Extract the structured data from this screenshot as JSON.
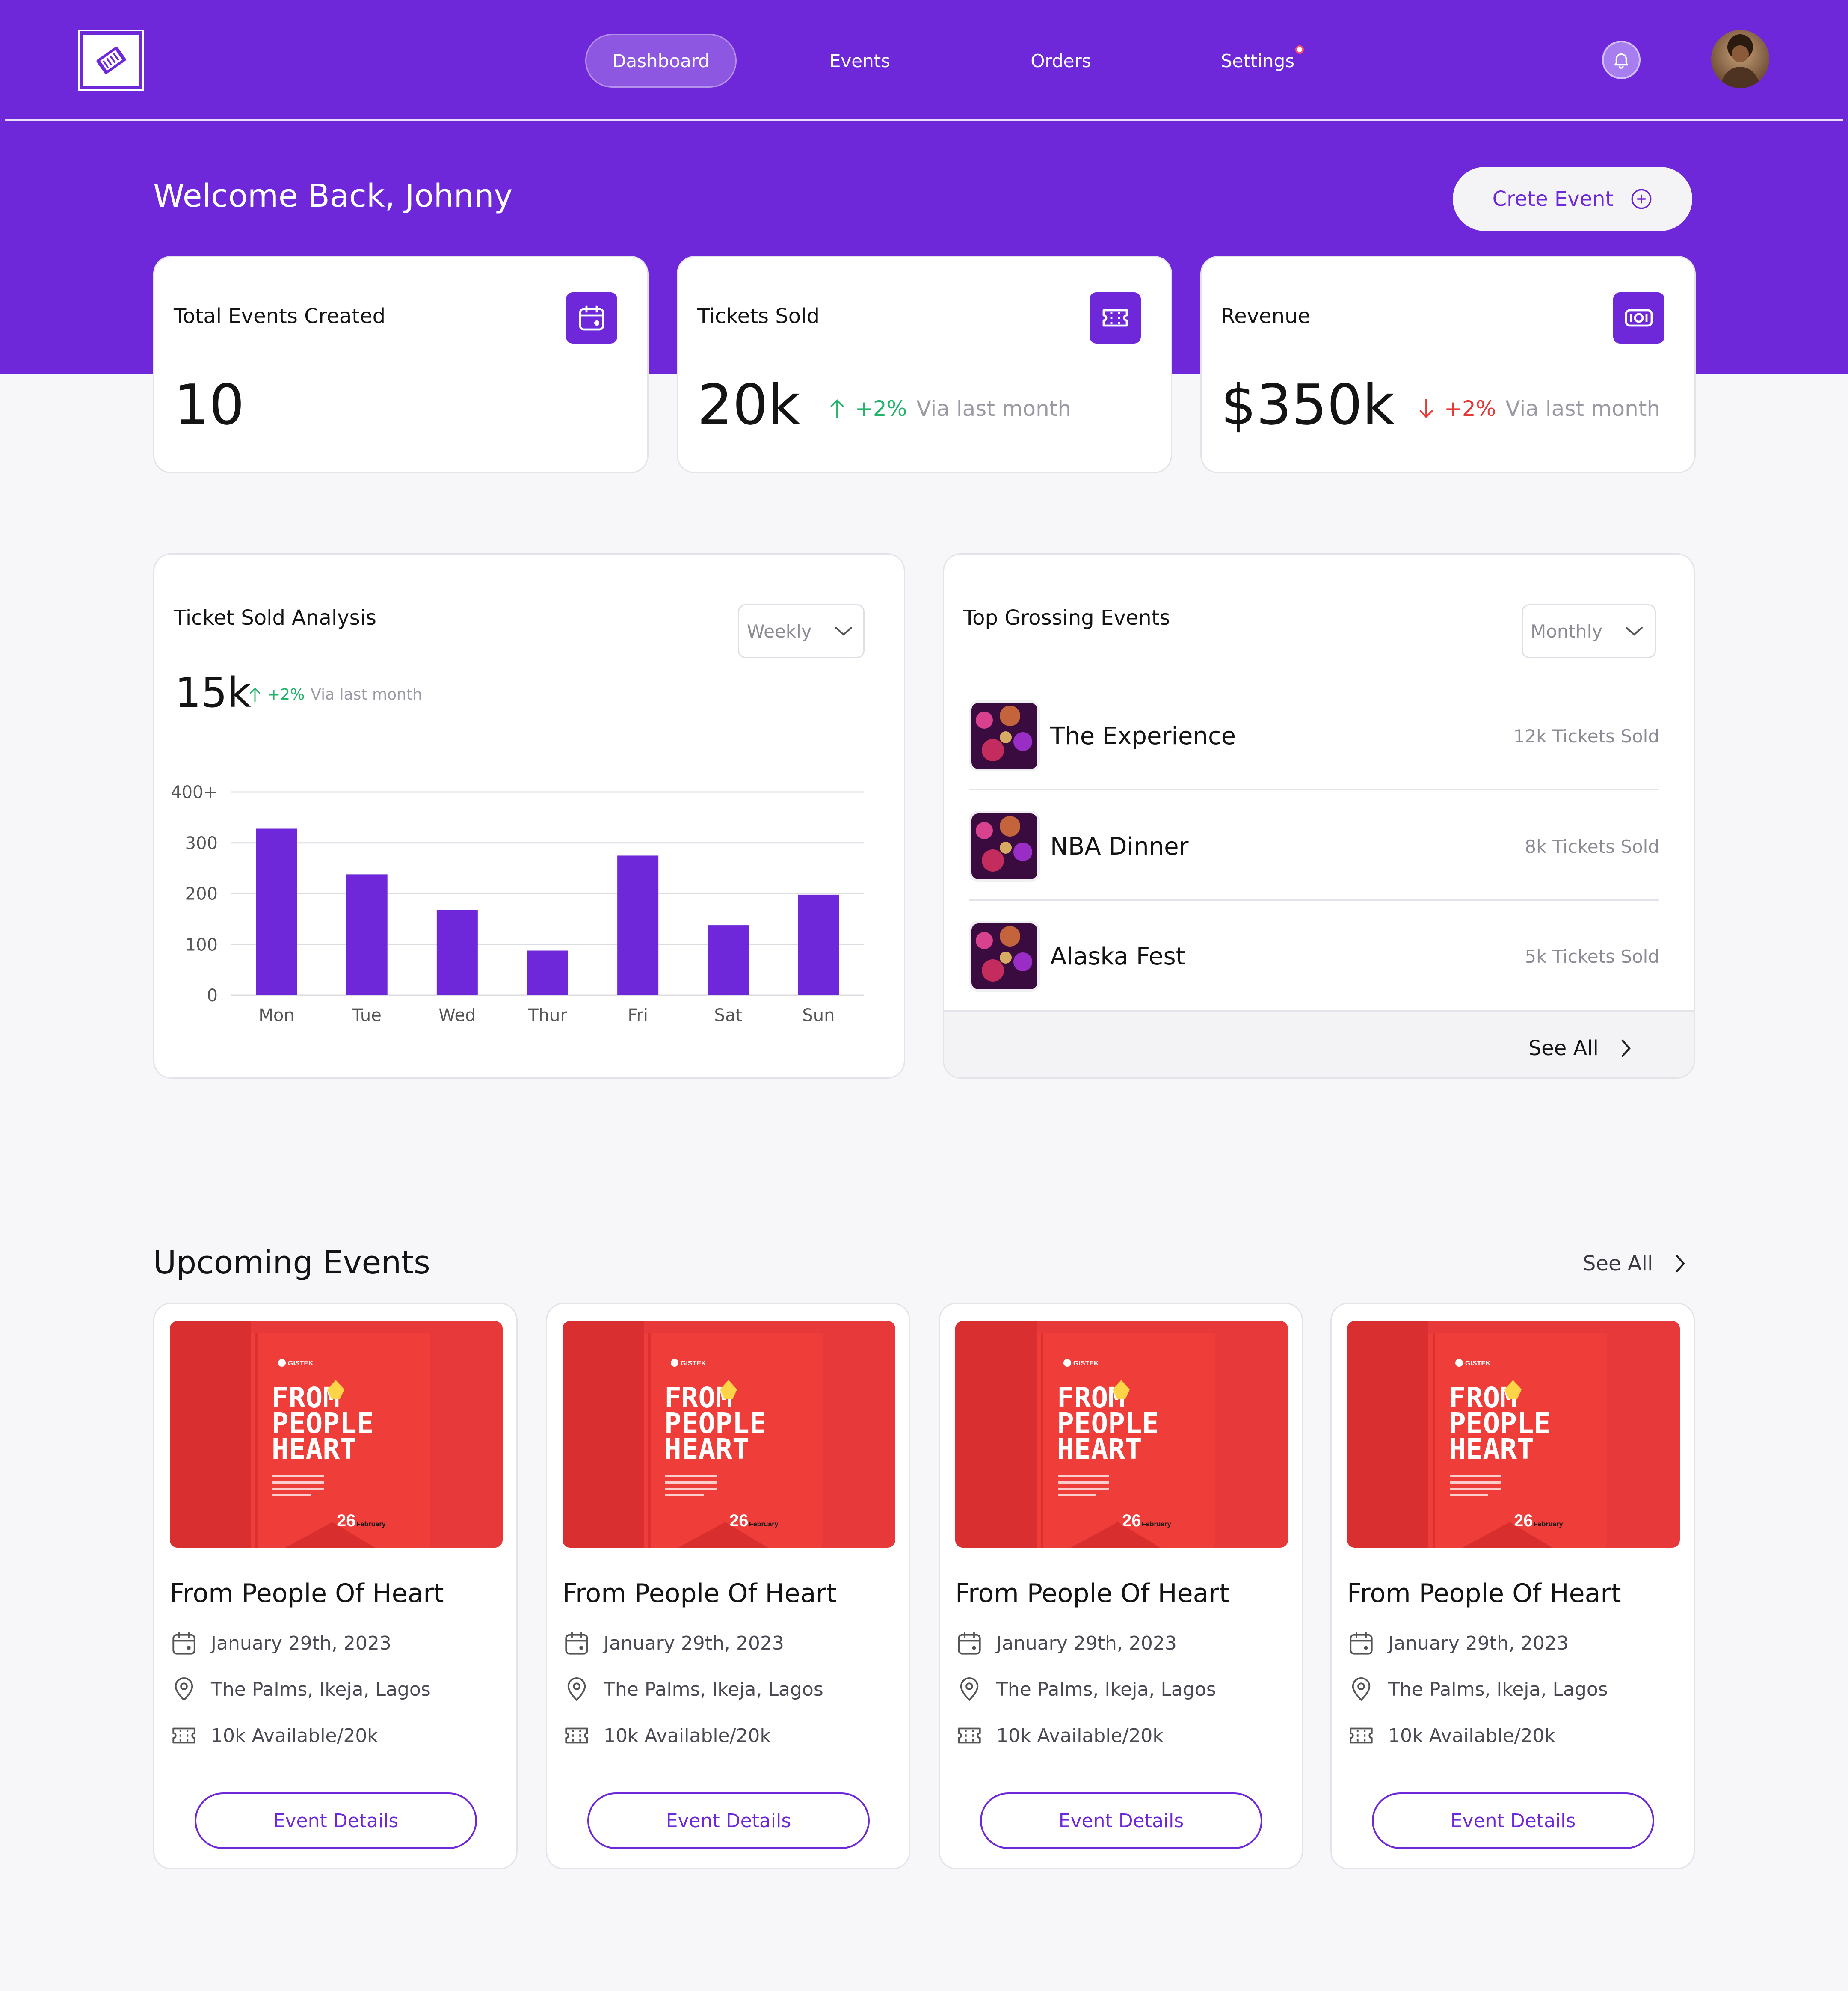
{
  "nav": {
    "items": [
      {
        "label": "Dashboard",
        "active": true
      },
      {
        "label": "Events",
        "active": false
      },
      {
        "label": "Orders",
        "active": false
      },
      {
        "label": "Settings",
        "active": false
      }
    ],
    "icons": {
      "logo": "ticket-logo-icon",
      "bell": "bell-icon",
      "avatar": "user-avatar"
    }
  },
  "header": {
    "welcome": "Welcome Back, Johnny",
    "create_button": "Crete Event"
  },
  "stats": [
    {
      "title": "Total Events Created",
      "value": "10",
      "icon": "calendar-icon"
    },
    {
      "title": "Tickets Sold",
      "value": "20k",
      "icon": "ticket-icon",
      "delta": "+2%",
      "delta_dir": "up",
      "delta_note": "Via last month"
    },
    {
      "title": "Revenue",
      "value": "$350k",
      "icon": "money-icon",
      "delta": "+2%",
      "delta_dir": "down",
      "delta_note": "Via last month"
    }
  ],
  "ticket_analysis": {
    "title": "Ticket Sold Analysis",
    "period": "Weekly",
    "value": "15k",
    "delta": "+2%",
    "delta_note": "Via last month"
  },
  "chart_data": {
    "type": "bar",
    "title": "Ticket Sold Analysis",
    "categories": [
      "Mon",
      "Tue",
      "Wed",
      "Thur",
      "Fri",
      "Sat",
      "Sun"
    ],
    "values": [
      328,
      238,
      168,
      88,
      275,
      138,
      198
    ],
    "ylim": [
      0,
      400
    ],
    "yticks": [
      "0",
      "100",
      "200",
      "300",
      "400+"
    ],
    "grid": true,
    "bar_color": "#6f28d9"
  },
  "top_events": {
    "title": "Top Grossing Events",
    "period": "Monthly",
    "items": [
      {
        "name": "The Experience",
        "tickets": "12k Tickets Sold"
      },
      {
        "name": "NBA Dinner",
        "tickets": "8k Tickets Sold"
      },
      {
        "name": "Alaska Fest",
        "tickets": "5k Tickets Sold"
      }
    ],
    "see_all": "See All"
  },
  "upcoming": {
    "title": "Upcoming Events",
    "see_all": "See All",
    "cards": [
      {
        "title": "From People Of Heart",
        "date": "January 29th, 2023",
        "location": "The Palms, Ikeja, Lagos",
        "availability": "10k Available/20k",
        "button": "Event Details",
        "poster_brand": "GISTEK",
        "poster_day": "26",
        "poster_month": "February"
      },
      {
        "title": "From People Of Heart",
        "date": "January 29th, 2023",
        "location": "The Palms, Ikeja, Lagos",
        "availability": "10k Available/20k",
        "button": "Event Details",
        "poster_brand": "GISTEK",
        "poster_day": "26",
        "poster_month": "February"
      },
      {
        "title": "From People Of Heart",
        "date": "January 29th, 2023",
        "location": "The Palms, Ikeja, Lagos",
        "availability": "10k Available/20k",
        "button": "Event Details",
        "poster_brand": "GISTEK",
        "poster_day": "26",
        "poster_month": "February"
      },
      {
        "title": "From People Of Heart",
        "date": "January 29th, 2023",
        "location": "The Palms, Ikeja, Lagos",
        "availability": "10k Available/20k",
        "button": "Event Details",
        "poster_brand": "GISTEK",
        "poster_day": "26",
        "poster_month": "February"
      }
    ]
  },
  "colors": {
    "brand": "#6f28d9",
    "up": "#22b46a",
    "down": "#e53935",
    "poster": "#e53935"
  }
}
